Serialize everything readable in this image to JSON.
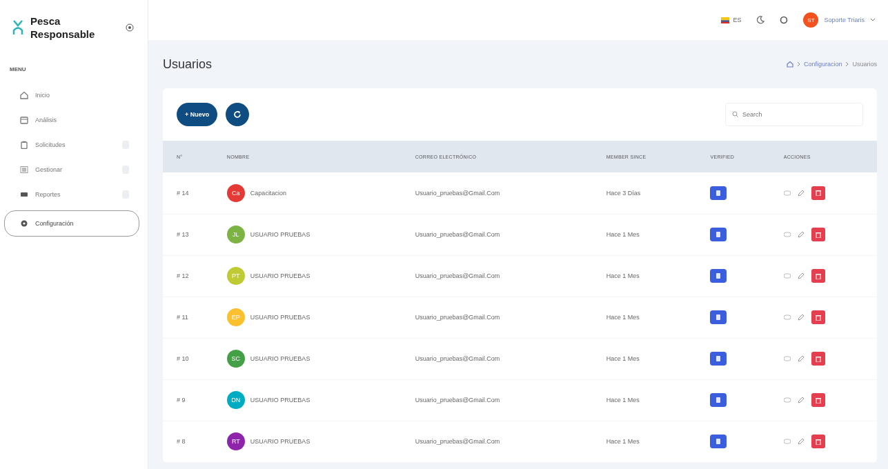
{
  "brand": {
    "name": "Pesca Responsable"
  },
  "sidebar": {
    "heading": "MENU",
    "items": [
      {
        "label": "Inicio",
        "expandable": false,
        "selected": false
      },
      {
        "label": "Análisis",
        "expandable": false,
        "selected": false
      },
      {
        "label": "Solicitudes",
        "expandable": true,
        "selected": false
      },
      {
        "label": "Gestionar",
        "expandable": true,
        "selected": false
      },
      {
        "label": "Reportes",
        "expandable": true,
        "selected": false
      },
      {
        "label": "Configuración",
        "expandable": false,
        "selected": true
      }
    ]
  },
  "topbar": {
    "language": "ES",
    "user": {
      "initials": "ST",
      "name": "Soporte Triaris"
    }
  },
  "page": {
    "title": "Usuarios",
    "breadcrumb": [
      "Configuracion",
      "Usuarios"
    ]
  },
  "toolbar": {
    "new_button": "+ Nuevo",
    "search": {
      "placeholder": "Search"
    }
  },
  "table": {
    "columns": [
      "N°",
      "NOMBRE",
      "CORREO ELECTRÓNICO",
      "MEMBER SINCE",
      "VERIFIED",
      "ACCIONES"
    ],
    "rows": [
      {
        "number": "# 14",
        "initials": "Ca",
        "color": "#e53935",
        "name": "Capacitacion",
        "email": "Usuario_pruebas@Gmail.Com",
        "since": "Hace 3 Días",
        "verified": true
      },
      {
        "number": "# 13",
        "initials": "JL",
        "color": "#7cb342",
        "name": "USUARIO PRUEBAS",
        "email": "Usuario_pruebas@Gmail.Com",
        "since": "Hace 1 Mes",
        "verified": true
      },
      {
        "number": "# 12",
        "initials": "PT",
        "color": "#c0ca33",
        "name": "USUARIO PRUEBAS",
        "email": "Usuario_pruebas@Gmail.Com",
        "since": "Hace 1 Mes",
        "verified": true
      },
      {
        "number": "# 11",
        "initials": "EP",
        "color": "#fbc02d",
        "name": "USUARIO PRUEBAS",
        "email": "Usuario_pruebas@Gmail.Com",
        "since": "Hace 1 Mes",
        "verified": true
      },
      {
        "number": "# 10",
        "initials": "SC",
        "color": "#43a047",
        "name": "USUARIO PRUEBAS",
        "email": "Usuario_pruebas@Gmail.Com",
        "since": "Hace 1 Mes",
        "verified": true
      },
      {
        "number": "# 9",
        "initials": "DN",
        "color": "#00acc1",
        "name": "USUARIO PRUEBAS",
        "email": "Usuario_pruebas@Gmail.Com",
        "since": "Hace 1 Mes",
        "verified": true
      },
      {
        "number": "# 8",
        "initials": "RT",
        "color": "#8e24aa",
        "name": "USUARIO PRUEBAS",
        "email": "Usuario_pruebas@Gmail.Com",
        "since": "Hace 1 Mes",
        "verified": true
      }
    ]
  }
}
